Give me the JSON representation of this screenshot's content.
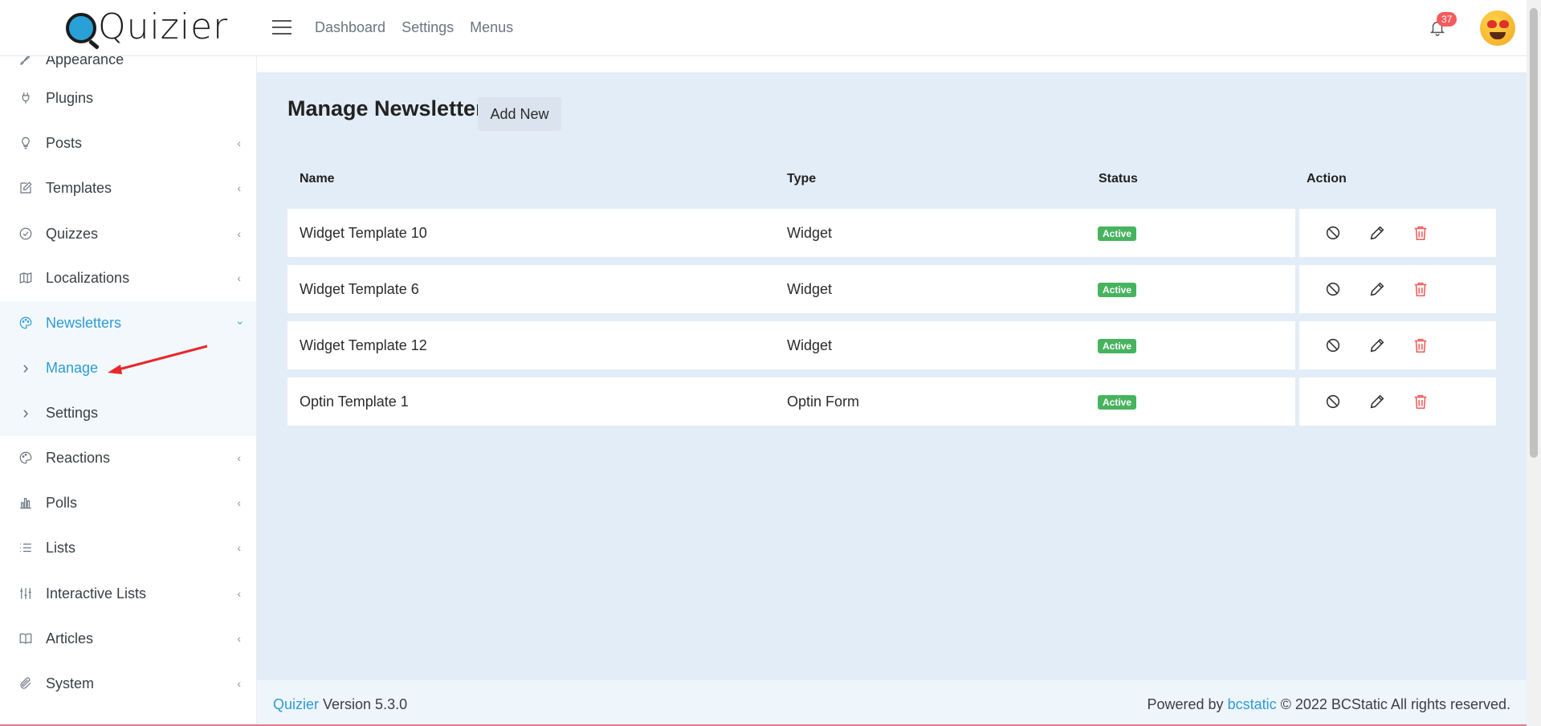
{
  "brand": {
    "name": "Quizier"
  },
  "topnav": {
    "items": [
      "Dashboard",
      "Settings",
      "Menus"
    ]
  },
  "notifications": {
    "count": "37"
  },
  "sidebar": {
    "items": [
      {
        "label": "Appearance",
        "icon": "brush-icon",
        "chevron": false
      },
      {
        "label": "Plugins",
        "icon": "plug-icon",
        "chevron": false
      },
      {
        "label": "Posts",
        "icon": "bulb-icon",
        "chevron": true
      },
      {
        "label": "Templates",
        "icon": "edit-icon",
        "chevron": true
      },
      {
        "label": "Quizzes",
        "icon": "check-circle-icon",
        "chevron": true
      },
      {
        "label": "Localizations",
        "icon": "map-icon",
        "chevron": true
      },
      {
        "label": "Newsletters",
        "icon": "palette-icon",
        "chevron": true,
        "expanded": true
      },
      {
        "label": "Reactions",
        "icon": "palette-icon",
        "chevron": true
      },
      {
        "label": "Polls",
        "icon": "bar-chart-icon",
        "chevron": true
      },
      {
        "label": "Lists",
        "icon": "list-icon",
        "chevron": true
      },
      {
        "label": "Interactive Lists",
        "icon": "sliders-icon",
        "chevron": true
      },
      {
        "label": "Articles",
        "icon": "book-icon",
        "chevron": true
      },
      {
        "label": "System",
        "icon": "paperclip-icon",
        "chevron": true
      }
    ],
    "subitems": [
      {
        "label": "Manage",
        "current": true
      },
      {
        "label": "Settings",
        "current": false
      }
    ]
  },
  "page": {
    "title": "Manage Newsletter",
    "add_button": "Add New"
  },
  "table": {
    "headers": [
      "Name",
      "Type",
      "Status",
      "Action"
    ],
    "rows": [
      {
        "name": "Widget Template 10",
        "type": "Widget",
        "status": "Active"
      },
      {
        "name": "Widget Template 6",
        "type": "Widget",
        "status": "Active"
      },
      {
        "name": "Widget Template 12",
        "type": "Widget",
        "status": "Active"
      },
      {
        "name": "Optin Template 1",
        "type": "Optin Form",
        "status": "Active"
      }
    ]
  },
  "footer": {
    "brand_link": "Quizier",
    "version": " Version 5.3.0",
    "powered_prefix": "Powered by ",
    "powered_link": "bcstatic",
    "copyright": " © 2022 BCStatic All rights reserved."
  },
  "colors": {
    "accent": "#2e9bd6",
    "active_badge": "#47b35f",
    "delete": "#f25c5c",
    "main_bg": "#e3edf7",
    "annotation_arrow": "#e8262b"
  }
}
